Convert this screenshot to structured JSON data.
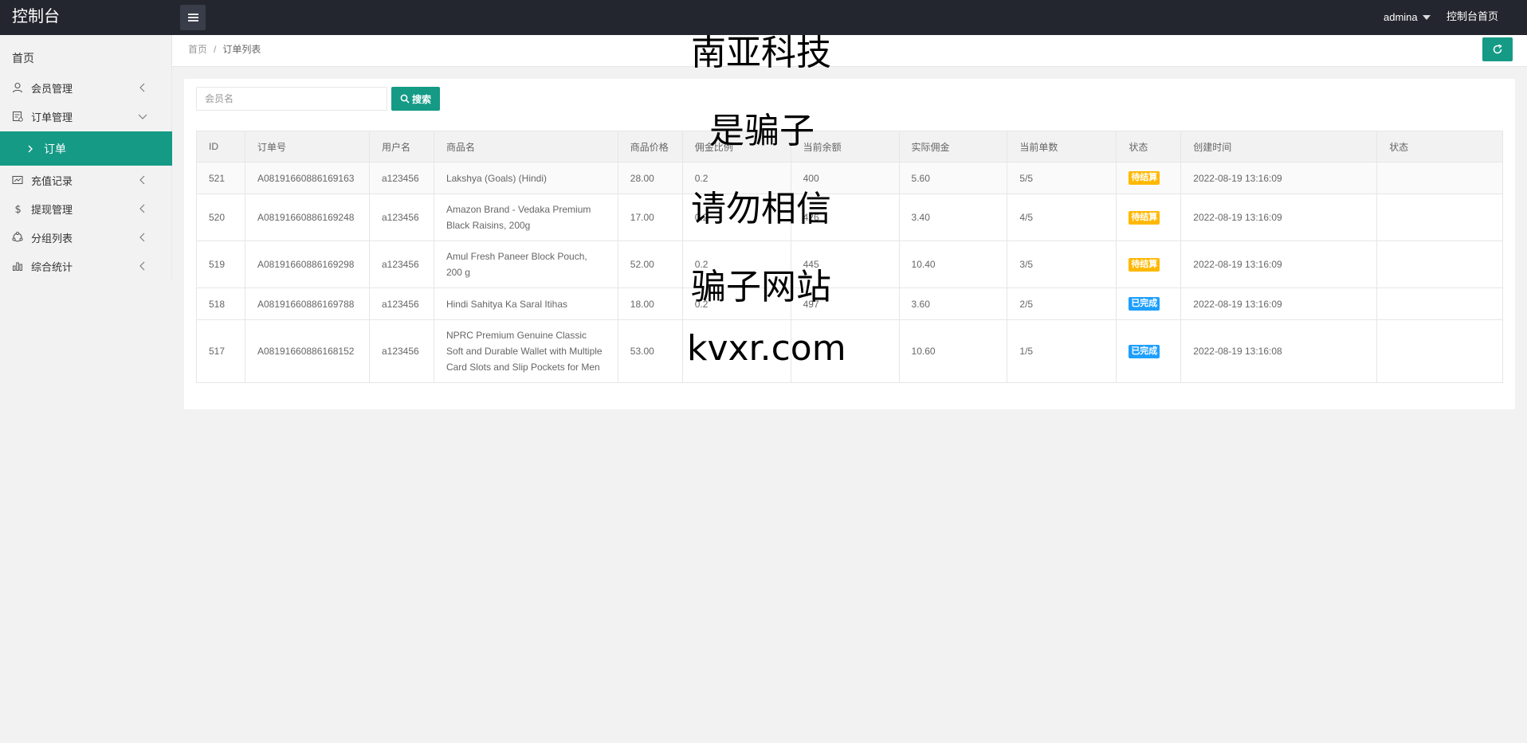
{
  "header": {
    "logo": "控制台",
    "user": "admina",
    "home_link": "控制台首页"
  },
  "sidebar": {
    "home": "首页",
    "items": [
      {
        "label": "会员管理",
        "icon": "user-icon"
      },
      {
        "label": "订单管理",
        "icon": "order-icon"
      },
      {
        "label": "订单",
        "icon": "chevron-right-icon",
        "active": true
      },
      {
        "label": "充值记录",
        "icon": "recharge-icon"
      },
      {
        "label": "提现管理",
        "icon": "dollar-icon"
      },
      {
        "label": "分组列表",
        "icon": "group-icon"
      },
      {
        "label": "综合统计",
        "icon": "chart-icon"
      }
    ]
  },
  "breadcrumb": {
    "home": "首页",
    "separator": "/",
    "current": "订单列表"
  },
  "search": {
    "placeholder": "会员名",
    "button_label": "搜索"
  },
  "table": {
    "columns": [
      "ID",
      "订单号",
      "用户名",
      "商品名",
      "商品价格",
      "佣金比例",
      "当前余额",
      "实际佣金",
      "当前单数",
      "状态",
      "创建时间",
      "状态"
    ],
    "rows": [
      {
        "id": "521",
        "order_no": "A08191660886169163",
        "user": "a123456",
        "product": "Lakshya (Goals) (Hindi)",
        "price": "28.00",
        "ratio": "0.2",
        "balance": "400",
        "commission": "5.60",
        "count": "5/5",
        "status": "待结算",
        "status_color": "#ffb800",
        "created": "2022-08-19 13:16:09",
        "action": ""
      },
      {
        "id": "520",
        "order_no": "A08191660886169248",
        "user": "a123456",
        "product": "Amazon Brand - Vedaka Premium Black Raisins, 200g",
        "price": "17.00",
        "ratio": "0.2",
        "balance": "426",
        "commission": "3.40",
        "count": "4/5",
        "status": "待结算",
        "status_color": "#ffb800",
        "created": "2022-08-19 13:16:09",
        "action": ""
      },
      {
        "id": "519",
        "order_no": "A08191660886169298",
        "user": "a123456",
        "product": "Amul Fresh Paneer Block Pouch, 200 g",
        "price": "52.00",
        "ratio": "0.2",
        "balance": "445",
        "commission": "10.40",
        "count": "3/5",
        "status": "待结算",
        "status_color": "#ffb800",
        "created": "2022-08-19 13:16:09",
        "action": ""
      },
      {
        "id": "518",
        "order_no": "A08191660886169788",
        "user": "a123456",
        "product": "Hindi Sahitya Ka Saral Itihas",
        "price": "18.00",
        "ratio": "0.2",
        "balance": "497",
        "commission": "3.60",
        "count": "2/5",
        "status": "已完成",
        "status_color": "#1e9fff",
        "created": "2022-08-19 13:16:09",
        "action": ""
      },
      {
        "id": "517",
        "order_no": "A08191660886168152",
        "user": "a123456",
        "product": "NPRC Premium Genuine Classic Soft and Durable Wallet with Multiple Card Slots and Slip Pockets for Men",
        "price": "53.00",
        "ratio": "",
        "balance": "",
        "commission": "10.60",
        "count": "1/5",
        "status": "已完成",
        "status_color": "#1e9fff",
        "created": "2022-08-19 13:16:08",
        "action": ""
      }
    ]
  },
  "watermark": [
    "南亚科技",
    "是骗子",
    "请勿相信",
    "骗子网站",
    "kvxr.com"
  ],
  "colors": {
    "header_bg": "#23262e",
    "accent": "#159a86",
    "pending": "#ffb800",
    "done": "#1e9fff"
  }
}
